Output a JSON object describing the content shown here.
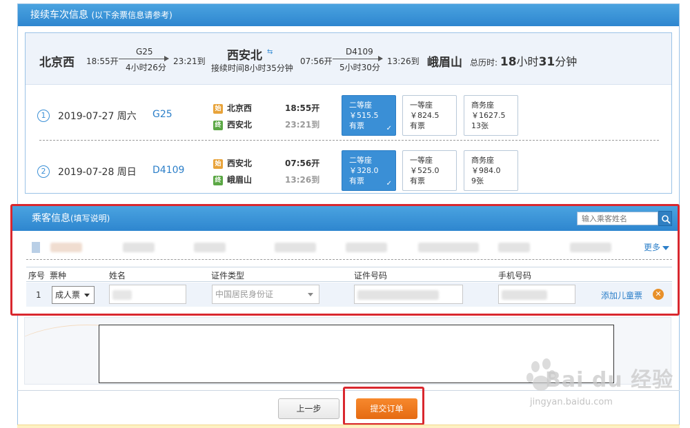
{
  "train_info": {
    "title": "接续车次信息",
    "note": "(以下余票信息请参考)",
    "summary": {
      "from_station": "北京西",
      "depart1": "18:55开",
      "train1": "G25",
      "duration1": "4小时26分",
      "arrive1": "23:21到",
      "transfer_station": "西安北",
      "transfer_time": "接续时间8小时35分钟",
      "depart2": "07:56开",
      "train2": "D4109",
      "duration2": "5小时30分",
      "arrive2": "13:26到",
      "to_station": "峨眉山",
      "total_label": "总历时:",
      "total_h": "18",
      "total_h_unit": "小时",
      "total_m": "31",
      "total_m_unit": "分钟"
    },
    "tag_start": "始",
    "tag_end": "终",
    "trips": [
      {
        "num": "1",
        "date": "2019-07-27 周六",
        "train": "G25",
        "from": "北京西",
        "depart": "18:55开",
        "to": "西安北",
        "arrive": "23:21到",
        "seats": [
          {
            "name": "二等座",
            "price": "￥515.5",
            "avail": "有票",
            "selected": true
          },
          {
            "name": "一等座",
            "price": "￥824.5",
            "avail": "有票",
            "selected": false
          },
          {
            "name": "商务座",
            "price": "￥1627.5",
            "avail": "13张",
            "selected": false
          }
        ]
      },
      {
        "num": "2",
        "date": "2019-07-28 周日",
        "train": "D4109",
        "from": "西安北",
        "depart": "07:56开",
        "to": "峨眉山",
        "arrive": "13:26到",
        "seats": [
          {
            "name": "二等座",
            "price": "￥328.0",
            "avail": "有票",
            "selected": true
          },
          {
            "name": "一等座",
            "price": "￥525.0",
            "avail": "有票",
            "selected": false
          },
          {
            "name": "商务座",
            "price": "￥984.0",
            "avail": "9张",
            "selected": false
          }
        ]
      }
    ]
  },
  "passenger": {
    "title": "乘客信息",
    "note": "(填写说明)",
    "search_placeholder": "输入乘客姓名",
    "more": "更多",
    "columns": [
      "序号",
      "票种",
      "姓名",
      "证件类型",
      "证件号码",
      "手机号码"
    ],
    "row": {
      "index": "1",
      "ticket_type": "成人票",
      "id_type": "中国居民身份证",
      "add_child": "添加儿童票"
    }
  },
  "actions": {
    "prev": "上一步",
    "submit": "提交订单"
  },
  "watermark": {
    "brand": "Bai du 经验",
    "url": "jingyan.baidu.com"
  },
  "colors": {
    "header_blue": "#2e86cf",
    "link_blue": "#2c7fc9",
    "selected_seat": "#3a8fd6",
    "highlight_red": "#d9272e",
    "submit_orange": "#f07a1e"
  }
}
